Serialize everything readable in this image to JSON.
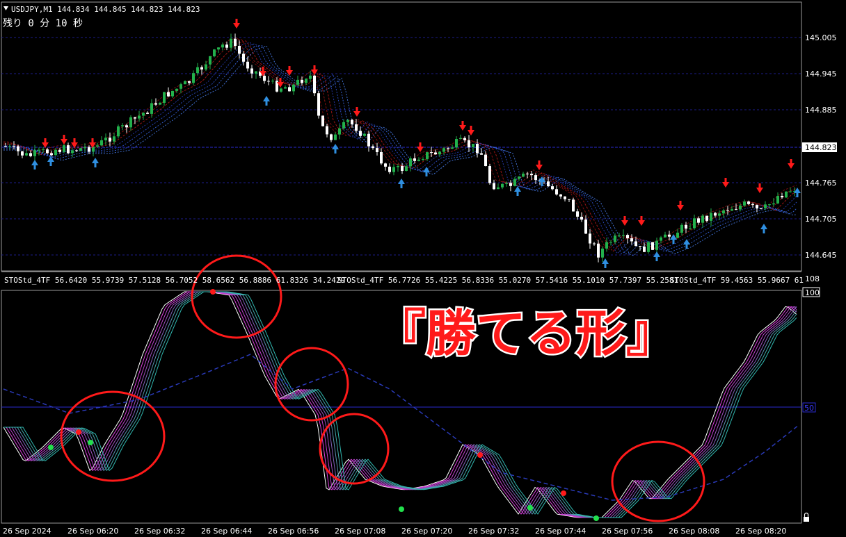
{
  "header": {
    "symbol_info": "USDJPY,M1  144.834 144.845 144.823 144.823",
    "timer": "残り 0 分 10 秒"
  },
  "price_axis": {
    "labels": [
      "145.005",
      "144.945",
      "144.885",
      "144.765",
      "144.705",
      "144.645"
    ],
    "current_price": "144.823"
  },
  "sub_window": {
    "indicator_text_1": "STOStd_4TF 56.6420 55.9739 57.5128 56.7052 58.6562 56.8886 61.8326 34.2429",
    "indicator_text_2": "STOStd_4TF 56.7726 55.4225 56.8336 55.0270 57.5416 55.1010 57.7397 55.2581",
    "indicator_text_3": "STOStd_4TF 59.4563 55.9667 61",
    "scale_top": "108",
    "scale_100": "100",
    "scale_50": "50"
  },
  "time_axis": {
    "labels": [
      "26 Sep 2024",
      "26 Sep 06:20",
      "26 Sep 06:32",
      "26 Sep 06:44",
      "26 Sep 06:56",
      "26 Sep 07:08",
      "26 Sep 07:20",
      "26 Sep 07:32",
      "26 Sep 07:44",
      "26 Sep 07:56",
      "26 Sep 08:08",
      "26 Sep 08:20"
    ]
  },
  "overlay": {
    "caption": "『勝てる形』"
  },
  "colors": {
    "background": "#000000",
    "bull_candle": "#22b14c",
    "bear_candle": "#ffffff",
    "grid": "#1c1c8a",
    "sell_arrow": "#ff1a1a",
    "buy_arrow": "#2f8fe0",
    "annotation_circle": "#ff1a1a"
  },
  "icons": {
    "symbol_dropdown": "triangle-down-icon",
    "sell_signal": "red-down-arrow-icon",
    "buy_signal": "blue-up-arrow-icon",
    "lock": "lock-icon"
  }
}
